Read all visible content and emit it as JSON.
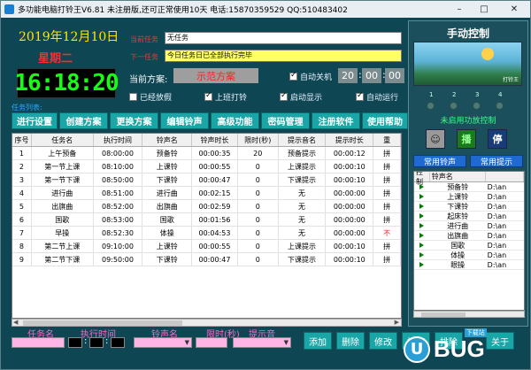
{
  "window": {
    "title": "多功能电脑打铃王V6.81 未注册版,还可正常使用10天 电话:15870359529 QQ:510483402",
    "minimize_icon": "minimize-icon",
    "maximize_icon": "maximize-icon",
    "close_icon": "close-icon"
  },
  "header": {
    "date": "2019年12月10日",
    "weekday": "星期二",
    "clock": "16:18:20",
    "current_task_label": "当前任务",
    "current_task_value": "无任务",
    "next_task_label": "下一任务",
    "next_task_value": "今日任务日已全部执行完毕",
    "current_plan_label": "当前方案:",
    "current_plan_value": "示范方案",
    "auto_shutdown_label": "自动关机",
    "shutdown_hour": "20",
    "shutdown_min": "00",
    "shutdown_sec": "00"
  },
  "options": {
    "holiday": {
      "label": "已经放假",
      "checked": false
    },
    "class_bell": {
      "label": "上班打铃",
      "checked": true
    },
    "auto_show": {
      "label": "启动显示",
      "checked": true
    },
    "auto_run": {
      "label": "自动运行",
      "checked": true
    }
  },
  "tasklist_label": "任务列表:",
  "toolbar": [
    "进行设置",
    "创建方案",
    "更换方案",
    "编辑铃声",
    "高级功能",
    "密码管理",
    "注册软件",
    "使用帮助"
  ],
  "table": {
    "headers": [
      "序号",
      "任务名",
      "执行时间",
      "铃声名",
      "铃声时长",
      "限时(秒)",
      "提示音名",
      "提示时长",
      "重"
    ],
    "rows": [
      [
        "1",
        "上午预备",
        "08:00:00",
        "预备铃",
        "00:00:35",
        "20",
        "预备提示",
        "00:00:12",
        "拼"
      ],
      [
        "2",
        "第一节上课",
        "08:10:00",
        "上课铃",
        "00:00:55",
        "0",
        "上课提示",
        "00:00:10",
        "拼"
      ],
      [
        "3",
        "第一节下课",
        "08:50:00",
        "下课铃",
        "00:00:47",
        "0",
        "下课提示",
        "00:00:10",
        "拼"
      ],
      [
        "4",
        "进行曲",
        "08:51:00",
        "进行曲",
        "00:02:15",
        "0",
        "无",
        "00:00:00",
        "拼"
      ],
      [
        "5",
        "出旗曲",
        "08:52:00",
        "出旗曲",
        "00:02:59",
        "0",
        "无",
        "00:00:00",
        "拼"
      ],
      [
        "6",
        "国歌",
        "08:53:00",
        "国歌",
        "00:01:56",
        "0",
        "无",
        "00:00:00",
        "拼"
      ],
      [
        "7",
        "早操",
        "08:52:30",
        "体操",
        "00:04:53",
        "0",
        "无",
        "00:00:00",
        "不"
      ],
      [
        "8",
        "第二节上课",
        "09:10:00",
        "上课铃",
        "00:00:55",
        "0",
        "上课提示",
        "00:00:10",
        "拼"
      ],
      [
        "9",
        "第二节下课",
        "09:50:00",
        "下课铃",
        "00:00:47",
        "0",
        "下课提示",
        "00:00:10",
        "拼"
      ]
    ]
  },
  "editor": {
    "task_name_label": "任务名",
    "exec_time_label": "执行时间",
    "ring_name_label": "铃声名",
    "limit_label": "限时(秒)",
    "prompt_label": "提示音"
  },
  "actions": [
    "添加",
    "删除",
    "修改",
    "排序",
    "排除",
    "关于"
  ],
  "manual": {
    "title": "手动控制",
    "banner_text": "打铃王",
    "numbers": [
      "1",
      "2",
      "3",
      "4"
    ],
    "status": "未启用功放控制",
    "ctrl_icons": [
      "manual-icon",
      "play-icon",
      "stop-icon"
    ],
    "ctrl_play_label": "播",
    "ctrl_stop_label": "停",
    "tab_bell": "常用铃声",
    "tab_prompt": "常用提示",
    "list_headers": [
      "控制",
      "铃声名",
      ""
    ],
    "list_items": [
      {
        "name": "预备铃",
        "path": "D:\\an"
      },
      {
        "name": "上课铃",
        "path": "D:\\an"
      },
      {
        "name": "下课铃",
        "path": "D:\\an"
      },
      {
        "name": "起床铃",
        "path": "D:\\an"
      },
      {
        "name": "进行曲",
        "path": "D:\\an"
      },
      {
        "name": "出旗曲",
        "path": "D:\\an"
      },
      {
        "name": "国歌",
        "path": "D:\\an"
      },
      {
        "name": "体操",
        "path": "D:\\an"
      },
      {
        "name": "眼操",
        "path": "D:\\an"
      }
    ]
  },
  "watermark": {
    "u": "U",
    "text": "BUG",
    "tag": "下载站"
  },
  "colors": {
    "background": "#0f4654",
    "accent": "#1aa6a6",
    "clock_green": "#15ff15",
    "date_yellow": "#ffe600"
  }
}
